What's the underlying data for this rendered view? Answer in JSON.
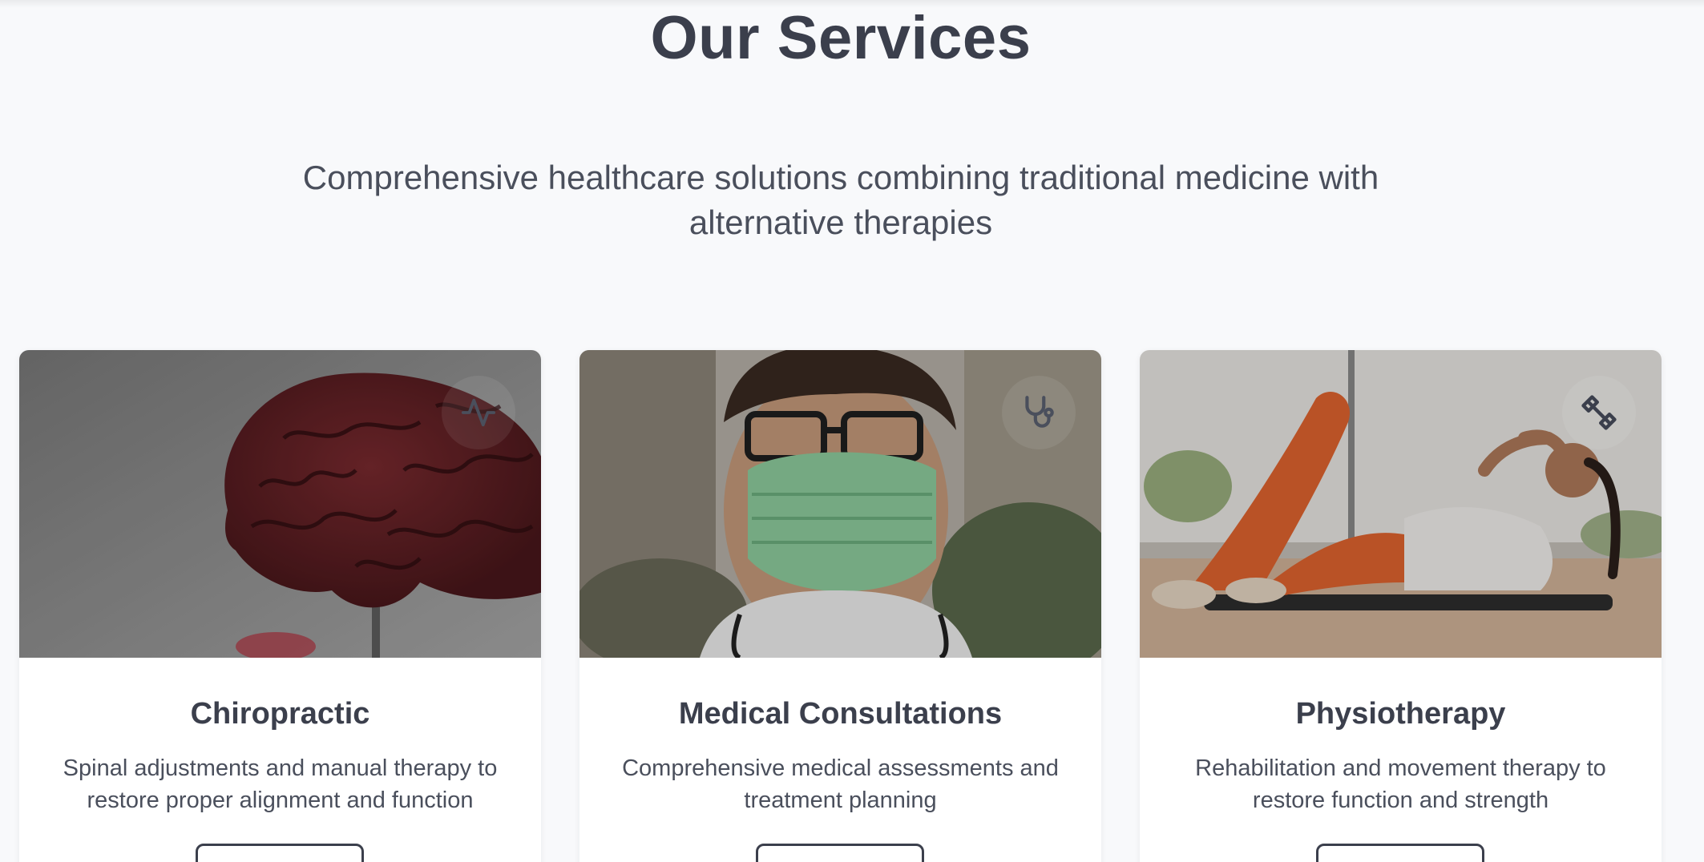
{
  "section": {
    "title": "Our Services",
    "subtitle": "Comprehensive healthcare solutions combining traditional medicine with alternative therapies"
  },
  "services": [
    {
      "title": "Chiropractic",
      "description": "Spinal adjustments and manual therapy to restore proper alignment and function",
      "icon": "activity-icon",
      "image": "brain-model-photo",
      "button_label": ""
    },
    {
      "title": "Medical Consultations",
      "description": "Comprehensive medical assessments and treatment planning",
      "icon": "stethoscope-icon",
      "image": "doctor-mask-photo",
      "button_label": ""
    },
    {
      "title": "Physiotherapy",
      "description": "Rehabilitation and movement therapy to restore function and strength",
      "icon": "dumbbell-icon",
      "image": "woman-exercise-photo",
      "button_label": ""
    }
  ],
  "colors": {
    "page_background": "#f8f9fb",
    "text_primary": "#3b3f4c",
    "text_secondary": "#4a4f5c",
    "card_background": "#ffffff"
  }
}
